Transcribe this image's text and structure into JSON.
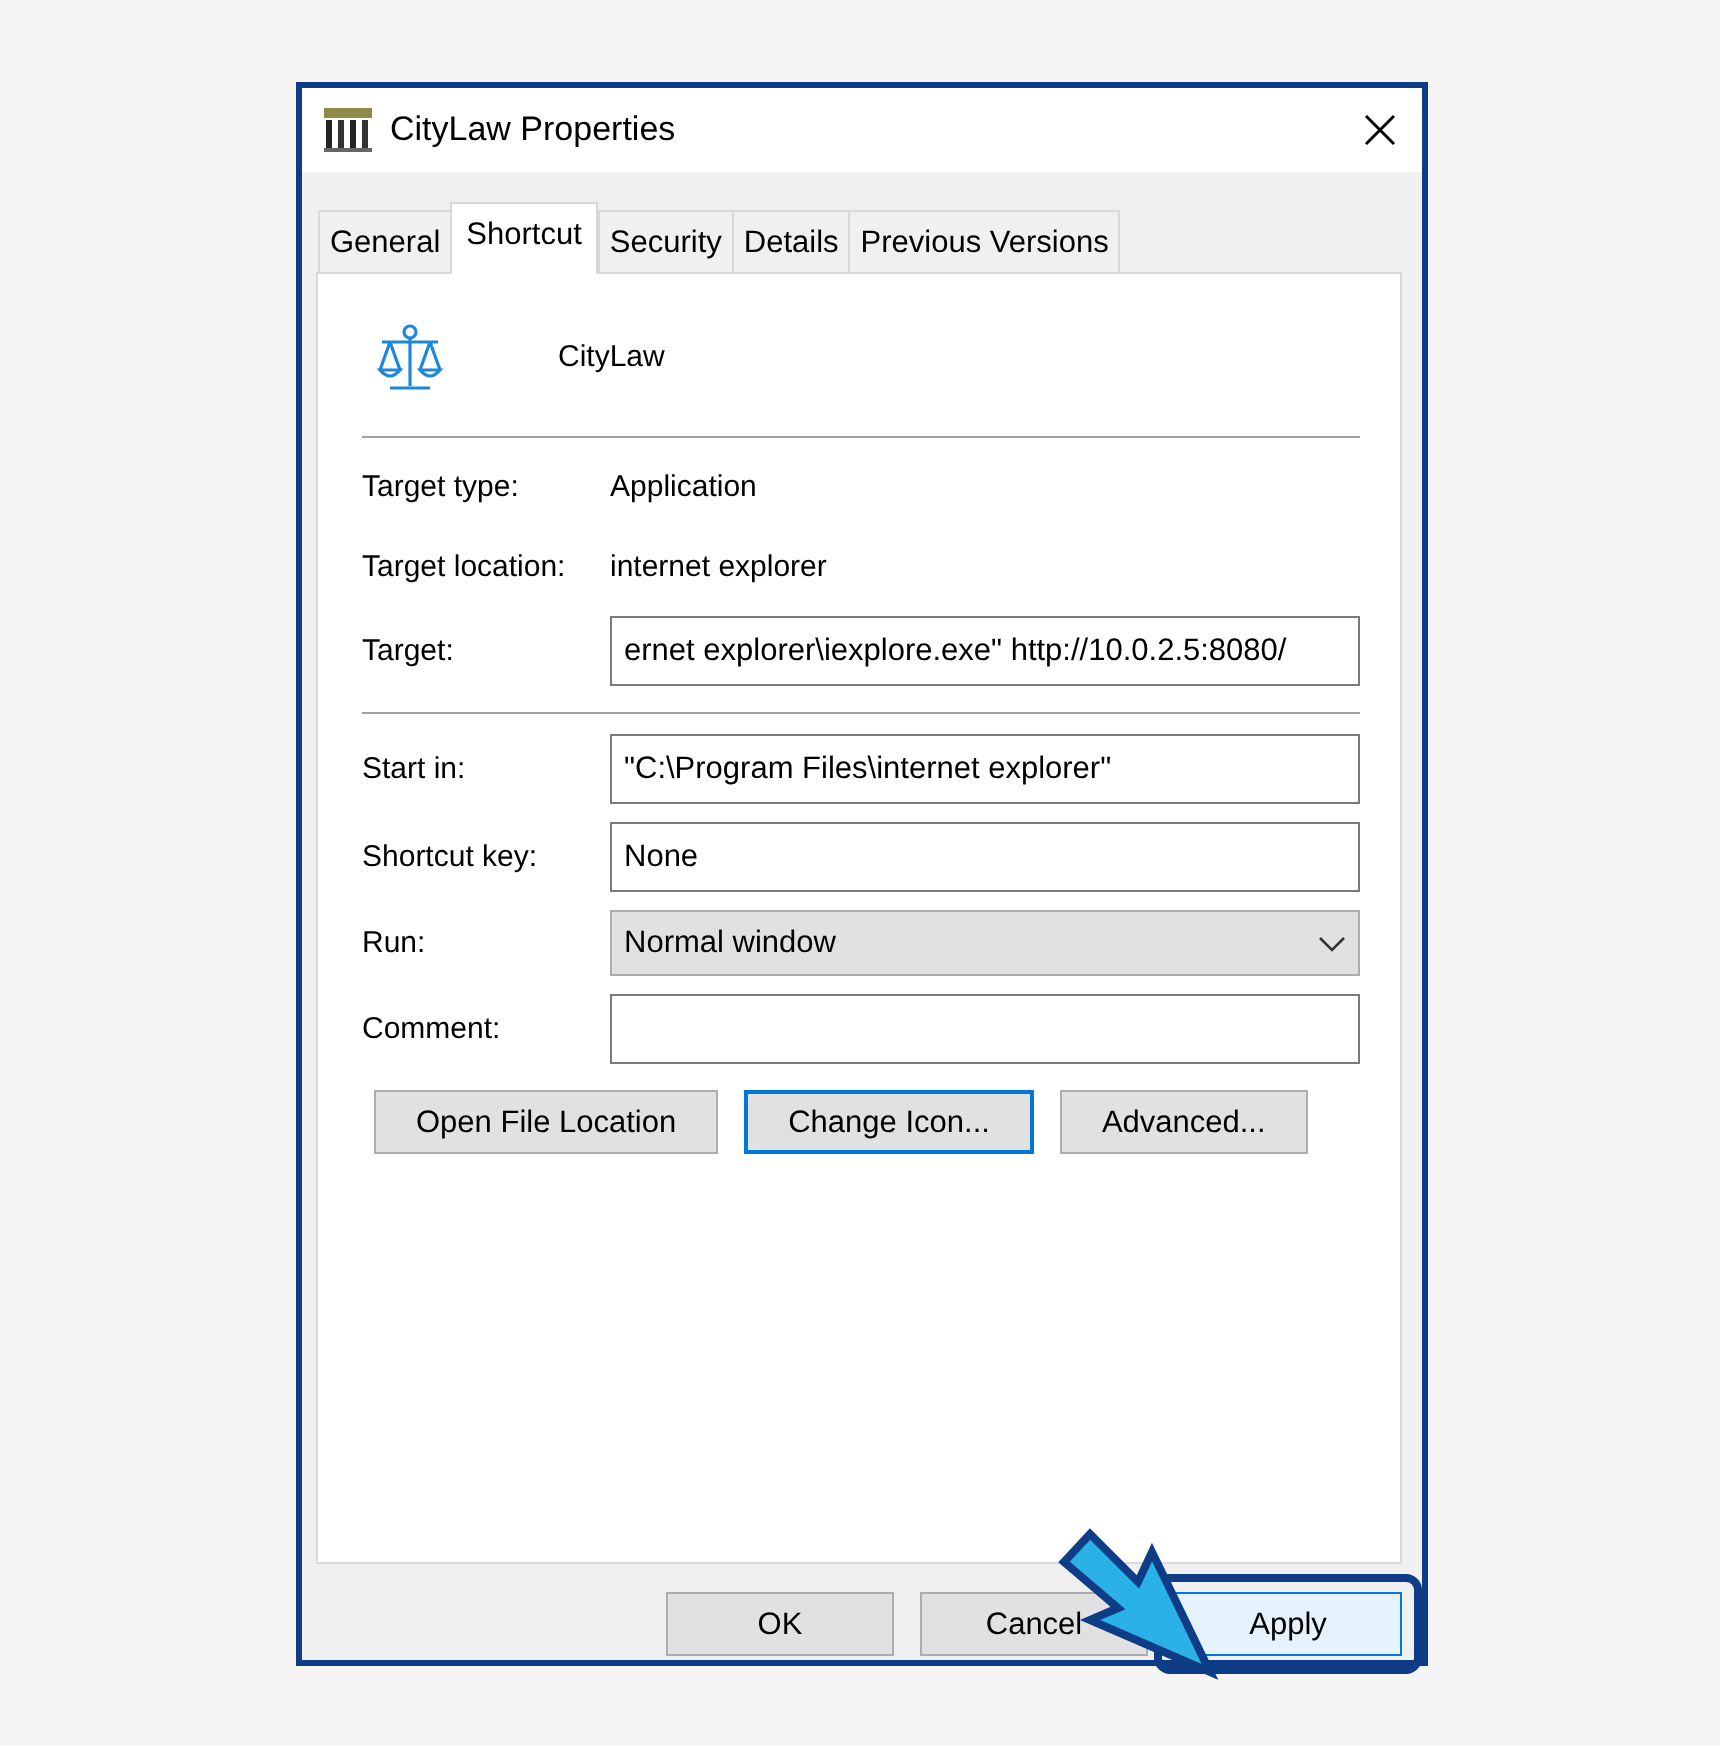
{
  "window": {
    "title": "CityLaw Properties"
  },
  "tabs": [
    {
      "label": "General",
      "selected": false
    },
    {
      "label": "Shortcut",
      "selected": true
    },
    {
      "label": "Security",
      "selected": false
    },
    {
      "label": "Details",
      "selected": false
    },
    {
      "label": "Previous Versions",
      "selected": false
    }
  ],
  "shortcut_name": "CityLaw",
  "properties": [
    {
      "kind": "text",
      "label": "Target type:",
      "value": "Application"
    },
    {
      "kind": "text",
      "label": "Target location:",
      "value": "internet explorer"
    },
    {
      "kind": "field",
      "label": "Target:",
      "value": "ernet explorer\\iexplore.exe\" http://10.0.2.5:8080/"
    },
    {
      "kind": "divider"
    },
    {
      "kind": "field",
      "label": "Start in:",
      "value": "\"C:\\Program Files\\internet explorer\""
    },
    {
      "kind": "field",
      "label": "Shortcut key:",
      "value": "None"
    },
    {
      "kind": "select",
      "label": "Run:",
      "value": "Normal window"
    },
    {
      "kind": "field",
      "label": "Comment:"
    }
  ],
  "action_buttons": [
    {
      "label": "Open File Location",
      "focused": false
    },
    {
      "label": "Change Icon...",
      "focused": true
    },
    {
      "label": "Advanced...",
      "focused": false
    }
  ],
  "footer_buttons": [
    {
      "label": "OK",
      "default": false,
      "highlighted": false
    },
    {
      "label": "Cancel",
      "default": false,
      "highlighted": false
    },
    {
      "label": "Apply",
      "default": true,
      "highlighted": true
    }
  ]
}
